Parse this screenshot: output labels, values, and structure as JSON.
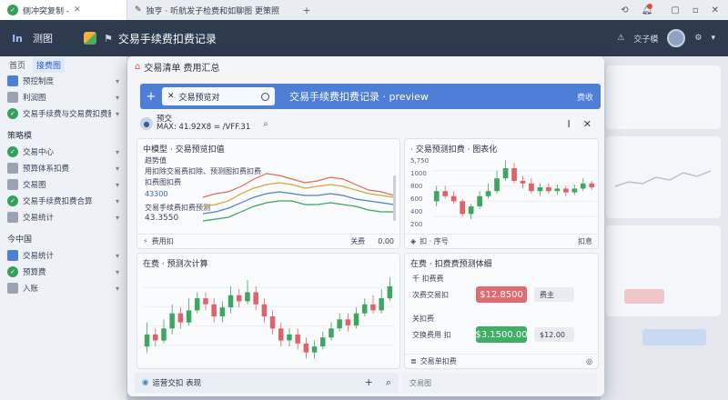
{
  "browser": {
    "active_tab": "侧冲突复制 -",
    "inactive_tab": "独亨 · 听航发子检费和如聊图  更策照",
    "tab_icon_badge": "🗸"
  },
  "app": {
    "brand": "测图",
    "header_title": "交易手续费扣费记录",
    "header_right_label": "交子模"
  },
  "sidebar": {
    "tabs": [
      "首页",
      "接费图"
    ],
    "items": [
      {
        "label": "预控制度",
        "icon": "blue"
      },
      {
        "label": "利润图",
        "icon": "gray"
      },
      {
        "label": "交易手续费与交易费扣费额",
        "icon": "green"
      }
    ],
    "section1": "策略模",
    "items2": [
      {
        "label": "交易中心",
        "icon": "green"
      },
      {
        "label": "预算体系扣费",
        "icon": "gray"
      },
      {
        "label": "交易图",
        "icon": "gray"
      },
      {
        "label": "交易手续费扣费合算",
        "icon": "green"
      },
      {
        "label": "交易统计",
        "icon": "gray"
      }
    ],
    "section2": "今中国",
    "items3": [
      {
        "label": "交易统计",
        "icon": "blue"
      },
      {
        "label": "预算费",
        "icon": "green"
      },
      {
        "label": "入账",
        "icon": "gray"
      }
    ]
  },
  "modal": {
    "title": "交易清单 费用汇总",
    "tab_label": "交易预览对",
    "bar_title": "交易手续费扣费记录 · preview",
    "bar_right": "费收",
    "search_line1": "预交",
    "search_line2": "MAX: 41.92X8 = /VFF.31",
    "panel1": {
      "head": "中模型 · 交易预览扣值",
      "lines": [
        "趋势值",
        "用扣除交易费扣除、预测图扣费扣费",
        "扣费图扣费",
        "43300",
        "交易手续费扣费预测"
      ],
      "value": "43.3550",
      "foot_left": "费用扣",
      "foot_mid": "关费",
      "foot_right": "0.00"
    },
    "panel2": {
      "head": "· 交易预测扣费 · 图表化",
      "foot_left": "扣 · 序号",
      "foot_right": "扣息"
    },
    "panel3": {
      "head": "在费 · 预测次计算"
    },
    "panel4": {
      "head": "在费 · 扣费费预测体细",
      "row1_label": "千  扣费费",
      "row2_label": "次费交易扣",
      "price1": "$12.8500",
      "chip1": "费主",
      "row3_label": "关扣费",
      "row4_label": "交换费用 扣",
      "price2": "$3.1500.00",
      "chip2": "$12.00",
      "foot": "交易单扣费"
    },
    "bottom_label": "运营交扣 表现",
    "bottom_right": "交易图"
  },
  "chart_data": [
    {
      "type": "line",
      "title": "中模型 · 交易预览扣值",
      "series": [
        {
          "color": "#e06b5a",
          "values": [
            35,
            37,
            38,
            41,
            45,
            48,
            47,
            45,
            43,
            44,
            46,
            45,
            42,
            39,
            38,
            36
          ]
        },
        {
          "color": "#d9a43c",
          "values": [
            30,
            31,
            33,
            37,
            40,
            42,
            43,
            42,
            40,
            41,
            42,
            41,
            39,
            37,
            36,
            35
          ]
        },
        {
          "color": "#4f7fd4",
          "values": [
            26,
            27,
            29,
            32,
            35,
            37,
            38,
            37,
            36,
            36,
            37,
            36,
            34,
            33,
            32,
            31
          ]
        },
        {
          "color": "#3d9f63",
          "values": [
            22,
            23,
            24,
            27,
            30,
            32,
            33,
            33,
            31,
            31,
            32,
            31,
            30,
            28,
            27,
            27
          ]
        }
      ]
    },
    {
      "type": "candlestick",
      "title": "· 交易预测扣费 · 图表化",
      "yticks": [
        "5,750",
        "1000",
        "800",
        "600",
        "400",
        "200"
      ],
      "candles": [
        [
          520,
          560,
          500,
          580
        ],
        [
          560,
          540,
          530,
          580
        ],
        [
          540,
          520,
          510,
          560
        ],
        [
          520,
          470,
          460,
          530
        ],
        [
          470,
          500,
          450,
          510
        ],
        [
          500,
          540,
          490,
          560
        ],
        [
          540,
          560,
          530,
          590
        ],
        [
          560,
          610,
          550,
          640
        ],
        [
          610,
          650,
          600,
          680
        ],
        [
          650,
          600,
          590,
          670
        ],
        [
          600,
          590,
          570,
          620
        ],
        [
          590,
          560,
          550,
          610
        ],
        [
          560,
          575,
          540,
          590
        ],
        [
          575,
          560,
          550,
          590
        ],
        [
          560,
          570,
          545,
          585
        ],
        [
          570,
          555,
          540,
          580
        ],
        [
          555,
          570,
          545,
          585
        ],
        [
          570,
          590,
          560,
          610
        ],
        [
          590,
          575,
          565,
          600
        ]
      ],
      "ylim": [
        400,
        700
      ]
    },
    {
      "type": "candlestick",
      "title": "在费 · 预测次计算",
      "candles": [
        [
          44,
          48,
          42,
          52
        ],
        [
          48,
          46,
          44,
          50
        ],
        [
          46,
          50,
          45,
          53
        ],
        [
          50,
          55,
          48,
          58
        ],
        [
          55,
          52,
          50,
          57
        ],
        [
          52,
          56,
          51,
          60
        ],
        [
          56,
          60,
          55,
          62
        ],
        [
          60,
          58,
          56,
          62
        ],
        [
          58,
          54,
          52,
          60
        ],
        [
          54,
          57,
          52,
          59
        ],
        [
          57,
          61,
          55,
          64
        ],
        [
          61,
          59,
          57,
          63
        ],
        [
          59,
          62,
          58,
          66
        ],
        [
          62,
          58,
          56,
          64
        ],
        [
          58,
          54,
          52,
          60
        ],
        [
          54,
          50,
          48,
          56
        ],
        [
          50,
          46,
          44,
          52
        ],
        [
          46,
          48,
          44,
          50
        ],
        [
          48,
          45,
          43,
          50
        ],
        [
          45,
          42,
          40,
          47
        ],
        [
          42,
          44,
          40,
          46
        ],
        [
          44,
          47,
          43,
          49
        ],
        [
          47,
          50,
          46,
          52
        ],
        [
          50,
          53,
          49,
          55
        ],
        [
          53,
          51,
          49,
          55
        ],
        [
          51,
          55,
          50,
          57
        ],
        [
          55,
          58,
          54,
          60
        ],
        [
          58,
          56,
          55,
          61
        ],
        [
          56,
          60,
          55,
          63
        ],
        [
          60,
          64,
          59,
          67
        ]
      ],
      "ylim": [
        38,
        70
      ]
    }
  ]
}
